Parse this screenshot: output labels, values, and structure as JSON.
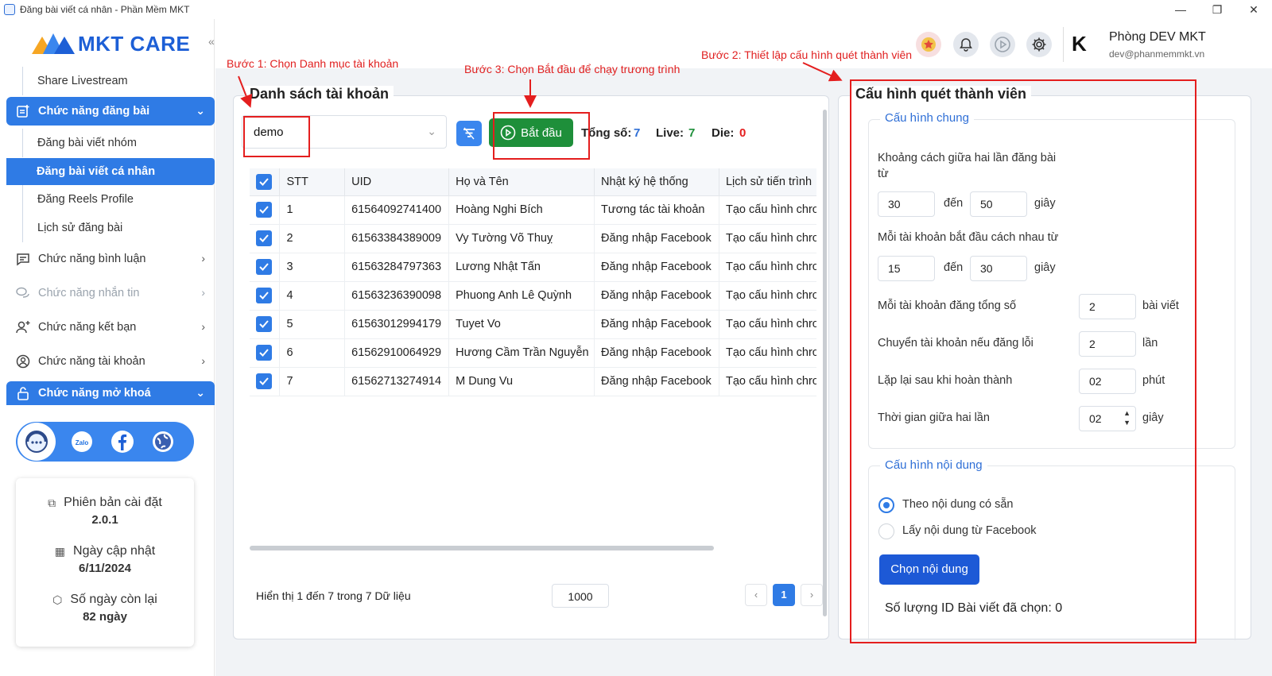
{
  "window": {
    "title": "Đăng bài viết cá nhân - Phần Mềm MKT",
    "minimize": "—",
    "maximize": "❐",
    "close": "✕"
  },
  "logo": {
    "text": "MKT CARE"
  },
  "sidebar": {
    "collapse": "«",
    "items": [
      {
        "label": "Share Livestream"
      },
      {
        "label": "Chức năng đăng bài"
      },
      {
        "label": "Đăng bài viết nhóm"
      },
      {
        "label": "Đăng bài viết cá nhân"
      },
      {
        "label": "Đăng Reels Profile"
      },
      {
        "label": "Lịch sử đăng bài"
      },
      {
        "label": "Chức năng bình luận"
      },
      {
        "label": "Chức năng nhắn tin"
      },
      {
        "label": "Chức năng kết bạn"
      },
      {
        "label": "Chức năng tài khoản"
      },
      {
        "label": "Chức năng mở khoá"
      }
    ],
    "social": {
      "zalo": "Zalo"
    },
    "info": {
      "version_label": "Phiên bản cài đặt",
      "version_value": "2.0.1",
      "updated_label": "Ngày cập nhật",
      "updated_value": "6/11/2024",
      "remaining_label": "Số ngày còn lại",
      "remaining_value": "82 ngày"
    }
  },
  "header": {
    "user_name": "Phòng DEV MKT",
    "user_email": "dev@phanmemmkt.vn",
    "avatar": "K"
  },
  "annotations": {
    "step1": "Bước 1: Chọn Danh mục tài khoản",
    "step2": "Bước 2: Thiết lập cấu hình quét thành viên",
    "step3": "Bước 3: Chọn Bắt đầu để chạy trương trình"
  },
  "accounts": {
    "title": "Danh sách tài khoản",
    "category_selected": "demo",
    "start_label": "Bắt đầu",
    "total_label": "Tổng số:",
    "total_value": "7",
    "live_label": "Live:",
    "live_value": "7",
    "die_label": "Die:",
    "die_value": "0",
    "columns": [
      "STT",
      "UID",
      "Họ và Tên",
      "Nhật ký hệ thống",
      "Lịch sử tiến trình"
    ],
    "rows": [
      {
        "stt": "1",
        "uid": "61564092741400",
        "name": "Hoàng Nghi Bích",
        "log": "Tương tác tài khoản",
        "history": "Tạo cấu hình chrome"
      },
      {
        "stt": "2",
        "uid": "61563384389009",
        "name": "Vy Tường Võ Thuỵ",
        "log": "Đăng nhập Facebook",
        "history": "Tạo cấu hình chrome"
      },
      {
        "stt": "3",
        "uid": "61563284797363",
        "name": "Lương Nhật Tấn",
        "log": "Đăng nhập Facebook",
        "history": "Tạo cấu hình chrome"
      },
      {
        "stt": "4",
        "uid": "61563236390098",
        "name": "Phuong Anh Lê Quỳnh",
        "log": "Đăng nhập Facebook",
        "history": "Tạo cấu hình chrome"
      },
      {
        "stt": "5",
        "uid": "61563012994179",
        "name": "Tuyet Vo",
        "log": "Đăng nhập Facebook",
        "history": "Tạo cấu hình chrome"
      },
      {
        "stt": "6",
        "uid": "61562910064929",
        "name": "Hương Cầm Trần Nguyễn",
        "log": "Đăng nhập Facebook",
        "history": "Tạo cấu hình chrome"
      },
      {
        "stt": "7",
        "uid": "61562713274914",
        "name": "M Dung Vu",
        "log": "Đăng nhập Facebook",
        "history": "Tạo cấu hình chrome"
      }
    ],
    "footer_text": "Hiển thị 1 đến 7 trong 7 Dữ liệu",
    "page_size": "1000",
    "current_page": "1",
    "prev": "‹",
    "next": "›"
  },
  "config": {
    "title": "Cấu hình quét thành viên",
    "general": {
      "legend": "Cấu hình chung",
      "interval_label": "Khoảng cách giữa hai lần đăng bài từ",
      "interval_from": "30",
      "interval_to": "50",
      "to_word": "đến",
      "seconds": "giây",
      "account_gap_label": "Mỗi tài khoản bắt đầu cách nhau từ",
      "account_gap_from": "15",
      "account_gap_to": "30",
      "total_posts_label": "Mỗi tài khoản đăng tổng số",
      "total_posts_value": "2",
      "total_posts_unit": "bài viết",
      "switch_label": "Chuyển tài khoản nếu đăng lỗi",
      "switch_value": "2",
      "switch_unit": "lần",
      "repeat_label": "Lặp lại sau khi hoàn thành",
      "repeat_value": "02",
      "repeat_unit": "phút",
      "between_label": "Thời gian giữa hai lần",
      "between_value": "02",
      "between_unit": "giây"
    },
    "content": {
      "legend": "Cấu hình nội dung",
      "option1": "Theo nội dung có sẵn",
      "option2": "Lấy nội dung từ Facebook",
      "choose_button": "Chọn nội dung",
      "selected_count_label": "Số lượng ID Bài viết đã chọn: 0"
    }
  },
  "colors": {
    "accent": "#2f7be5",
    "start_green": "#1e8f3a",
    "annotation_red": "#e41e1e",
    "live_green": "#1e8f3a",
    "die_red": "#e41e1e"
  }
}
